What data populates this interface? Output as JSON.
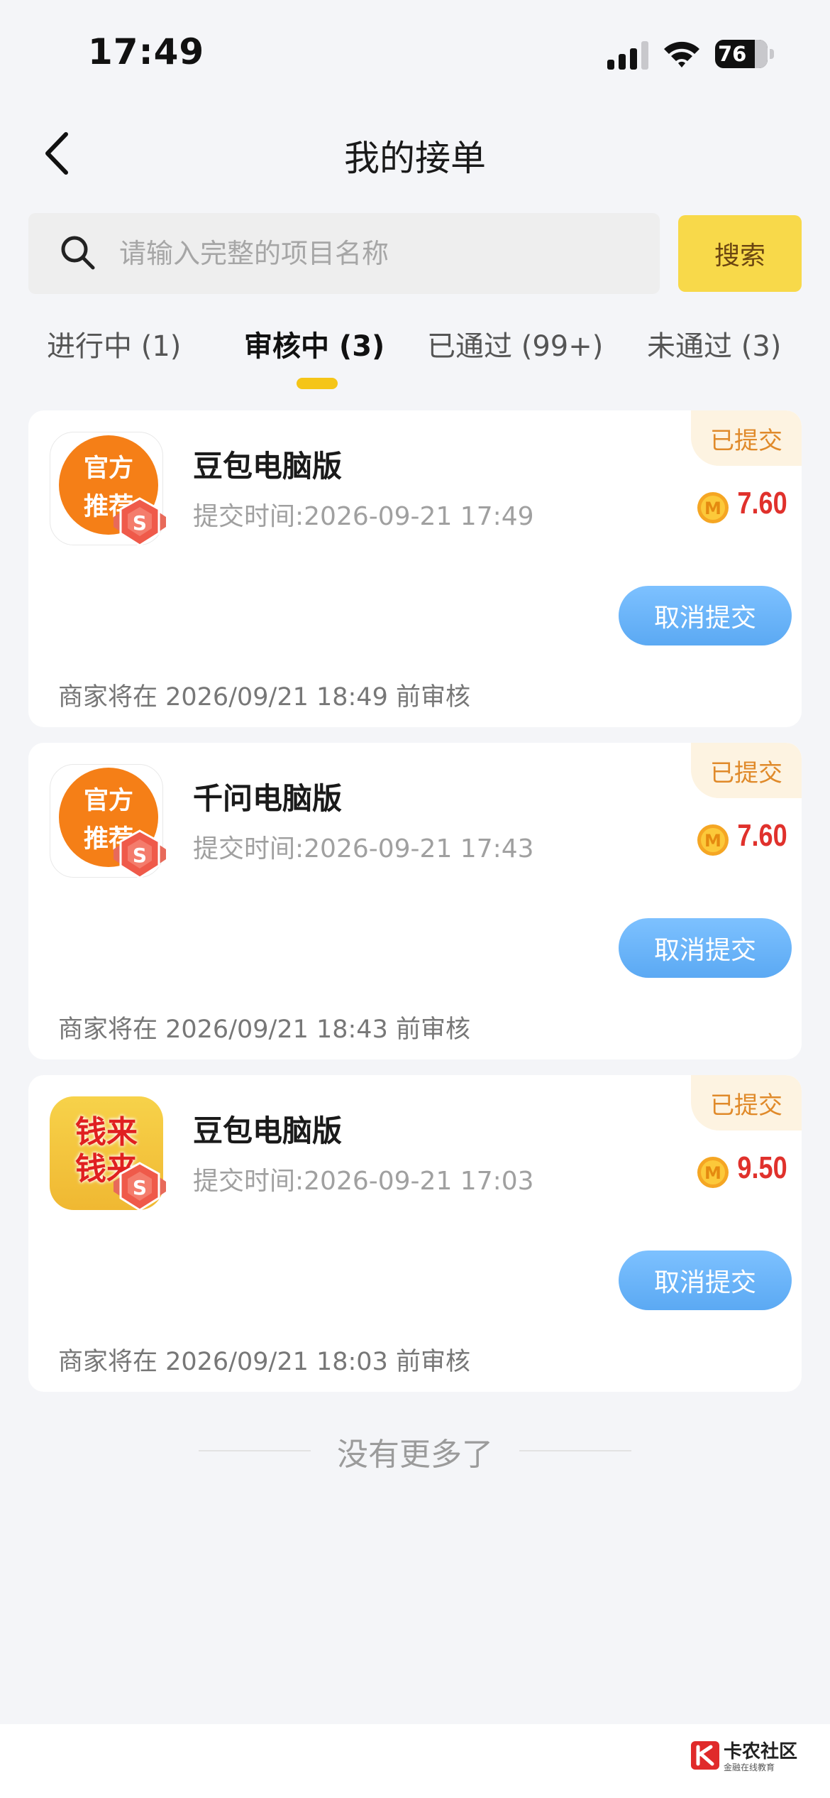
{
  "status_bar": {
    "time": "17:49",
    "battery": "76"
  },
  "header": {
    "title": "我的接单"
  },
  "search": {
    "placeholder": "请输入完整的项目名称",
    "button_label": "搜索"
  },
  "tabs": [
    {
      "label": "进行中 (1)",
      "active": false
    },
    {
      "label": "审核中 (3)",
      "active": true
    },
    {
      "label": "已通过 (99+)",
      "active": false
    },
    {
      "label": "未通过 (3)",
      "active": false
    }
  ],
  "orders": [
    {
      "icon": "official-recommend-icon",
      "icon_lines": [
        "官方",
        "推荐"
      ],
      "title": "豆包电脑版",
      "submit_time": "提交时间:2026-09-21 17:49",
      "status": "已提交",
      "reward": "7.60",
      "cancel_label": "取消提交",
      "review_note": "商家将在 2026/09/21 18:49 前审核"
    },
    {
      "icon": "official-recommend-icon",
      "icon_lines": [
        "官方",
        "推荐"
      ],
      "title": "千问电脑版",
      "submit_time": "提交时间:2026-09-21 17:43",
      "status": "已提交",
      "reward": "7.60",
      "cancel_label": "取消提交",
      "review_note": "商家将在 2026/09/21 18:43 前审核"
    },
    {
      "icon": "money-coming-icon",
      "icon_lines": [
        "钱来",
        "钱来"
      ],
      "title": "豆包电脑版",
      "submit_time": "提交时间:2026-09-21 17:03",
      "status": "已提交",
      "reward": "9.50",
      "cancel_label": "取消提交",
      "review_note": "商家将在 2026/09/21 18:03 前审核"
    }
  ],
  "list_end": "没有更多了",
  "watermark": {
    "title": "卡农社区",
    "subtitle": "金融在线教育"
  },
  "colors": {
    "accent": "#f8d94a",
    "reward": "#e0312c",
    "cancel_button": "#6cb5fa",
    "badge_text": "#e08a2a"
  }
}
